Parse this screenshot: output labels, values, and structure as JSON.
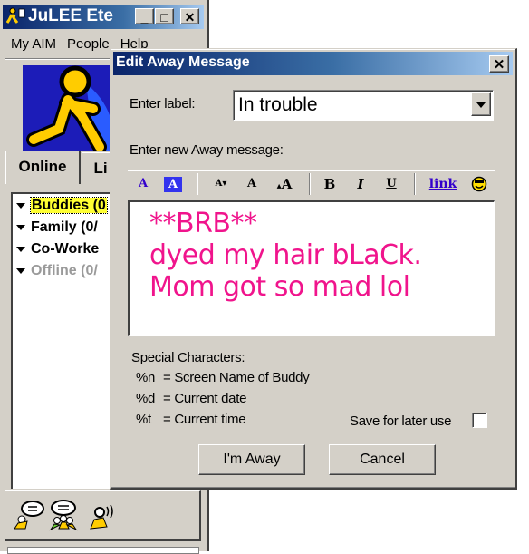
{
  "main_window": {
    "title": "JuLEE Ete",
    "caption_buttons": {
      "minimize": "_",
      "maximize": "□",
      "close": "✕"
    },
    "menu": [
      "My AIM",
      "People",
      "Help"
    ],
    "tabs": [
      {
        "label": "Online",
        "active": true
      },
      {
        "label": "Li",
        "active": false
      }
    ],
    "groups": [
      {
        "label": "Buddies (0",
        "selected": true,
        "offline": false
      },
      {
        "label": "Family (0/",
        "selected": false,
        "offline": false
      },
      {
        "label": "Co-Worke",
        "selected": false,
        "offline": false
      },
      {
        "label": "Offline (0/",
        "selected": false,
        "offline": true
      }
    ],
    "bottom_icons": [
      "send-im-icon",
      "chat-icon",
      "talk-icon"
    ]
  },
  "dialog": {
    "title": "Edit Away Message",
    "close": "✕",
    "enter_label": "Enter label:",
    "label_value": "In trouble",
    "enter_message": "Enter new Away message:",
    "toolbar": {
      "text_color": "A",
      "bg_color": "A",
      "smaller": "A",
      "normal": "A",
      "larger": "A",
      "bold": "B",
      "italic": "I",
      "underline": "U",
      "link": "link"
    },
    "message_lines": [
      "**BRB**",
      "dyed my hair bLaCk.",
      "Mom got so mad lol"
    ],
    "message_color": "#f0148c",
    "special_title": "Special Characters:",
    "special": [
      {
        "code": "%n",
        "desc": "= Screen Name of Buddy"
      },
      {
        "code": "%d",
        "desc": "= Current date"
      },
      {
        "code": "%t",
        "desc": "= Current time"
      }
    ],
    "save_label": "Save for later use",
    "save_checked": false,
    "away_button": "I'm Away",
    "cancel_button": "Cancel"
  }
}
